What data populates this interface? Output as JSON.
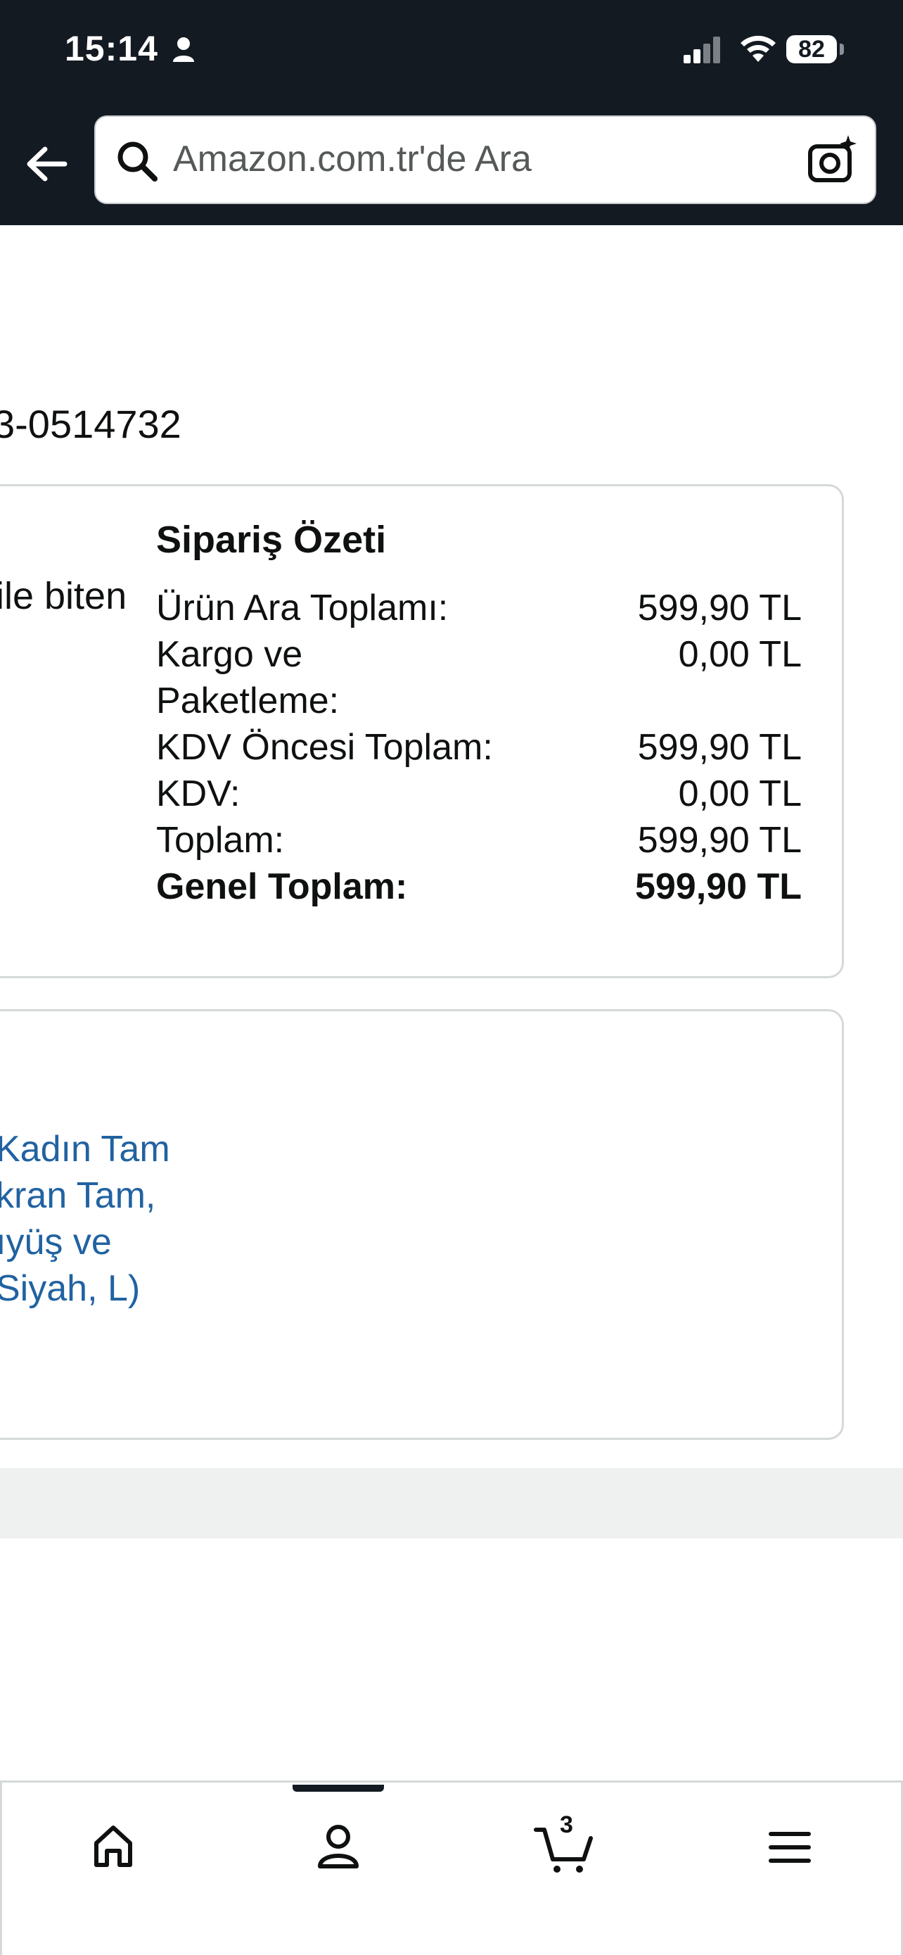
{
  "status_bar": {
    "time": "15:14",
    "battery": "82"
  },
  "search": {
    "placeholder": "Amazon.com.tr'de Ara"
  },
  "order": {
    "number_partial": "3-0514732",
    "payment_partial": "ile biten"
  },
  "summary": {
    "title": "Sipariş Özeti",
    "rows": [
      {
        "label": "Ürün Ara Toplamı:",
        "value": "599,90 TL"
      },
      {
        "label": "Kargo ve",
        "label2": "Paketleme:",
        "value": "0,00 TL"
      },
      {
        "label": "KDV Öncesi Toplam:",
        "value": "599,90 TL"
      },
      {
        "label": "KDV:",
        "value": "0,00 TL"
      },
      {
        "label": "Toplam:",
        "value": "599,90 TL"
      }
    ],
    "grand": {
      "label": "Genel Toplam:",
      "value": "599,90 TL"
    }
  },
  "product": {
    "title_lines": [
      " Kadın Tam",
      "kran Tam,",
      "ıyüş ve",
      "Siyah, L)"
    ],
    "link_color": "#2162a1"
  },
  "bottom_nav": {
    "cart_count": "3"
  },
  "colors": {
    "header_bg": "#131a22",
    "border": "#d5d9d9",
    "link": "#2162a1"
  }
}
